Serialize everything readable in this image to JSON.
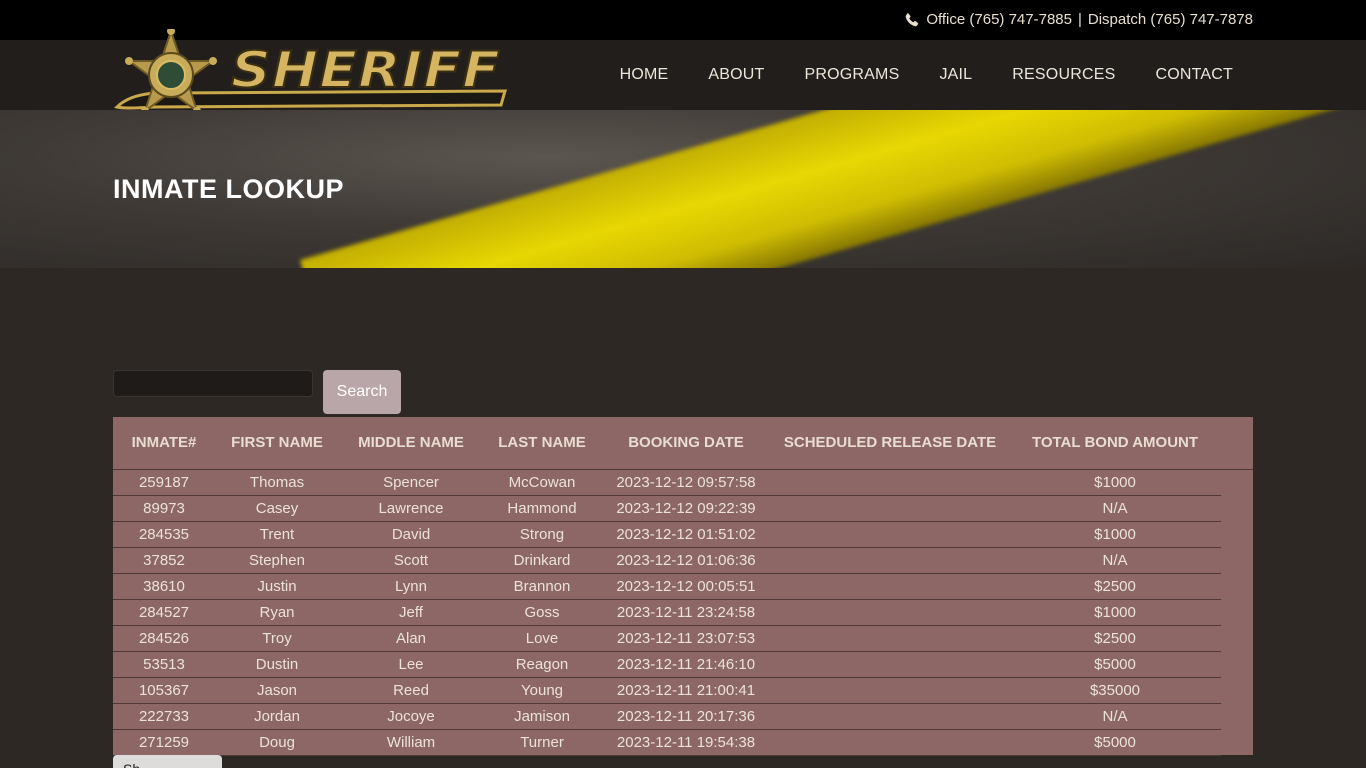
{
  "topbar": {
    "icon": "phone-icon",
    "office_label": "Office (765) 747-7885",
    "separator": "|",
    "dispatch_label": "Dispatch (765) 747-7878"
  },
  "logo": {
    "text": "SHERIFF"
  },
  "nav": {
    "items": [
      "HOME",
      "ABOUT",
      "PROGRAMS",
      "JAIL",
      "RESOURCES",
      "CONTACT"
    ]
  },
  "hero": {
    "title": "INMATE LOOKUP"
  },
  "search": {
    "value": "",
    "button_label": "Search"
  },
  "table": {
    "columns": [
      "INMATE#",
      "FIRST NAME",
      "MIDDLE NAME",
      "LAST NAME",
      "BOOKING DATE",
      "SCHEDULED RELEASE DATE",
      "TOTAL BOND AMOUNT"
    ],
    "rows": [
      [
        "259187",
        "Thomas",
        "Spencer",
        "McCowan",
        "2023-12-12 09:57:58",
        "",
        "$1000"
      ],
      [
        "89973",
        "Casey",
        "Lawrence",
        "Hammond",
        "2023-12-12 09:22:39",
        "",
        "N/A"
      ],
      [
        "284535",
        "Trent",
        "David",
        "Strong",
        "2023-12-12 01:51:02",
        "",
        "$1000"
      ],
      [
        "37852",
        "Stephen",
        "Scott",
        "Drinkard",
        "2023-12-12 01:06:36",
        "",
        "N/A"
      ],
      [
        "38610",
        "Justin",
        "Lynn",
        "Brannon",
        "2023-12-12 00:05:51",
        "",
        "$2500"
      ],
      [
        "284527",
        "Ryan",
        "Jeff",
        "Goss",
        "2023-12-11 23:24:58",
        "",
        "$1000"
      ],
      [
        "284526",
        "Troy",
        "Alan",
        "Love",
        "2023-12-11 23:07:53",
        "",
        "$2500"
      ],
      [
        "53513",
        "Dustin",
        "Lee",
        "Reagon",
        "2023-12-11 21:46:10",
        "",
        "$5000"
      ],
      [
        "105367",
        "Jason",
        "Reed",
        "Young",
        "2023-12-11 21:00:41",
        "",
        "$35000"
      ],
      [
        "222733",
        "Jordan",
        "Jocoye",
        "Jamison",
        "2023-12-11 20:17:36",
        "",
        "N/A"
      ],
      [
        "271259",
        "Doug",
        "William",
        "Turner",
        "2023-12-11 19:54:38",
        "",
        "$5000"
      ]
    ]
  },
  "show_more": {
    "label": "Sh"
  },
  "colors": {
    "page_bg": "#2e2824",
    "table_bg": "#8c6766",
    "button_bg": "#b9a6a8",
    "logo_gold": "#c9a94a"
  }
}
